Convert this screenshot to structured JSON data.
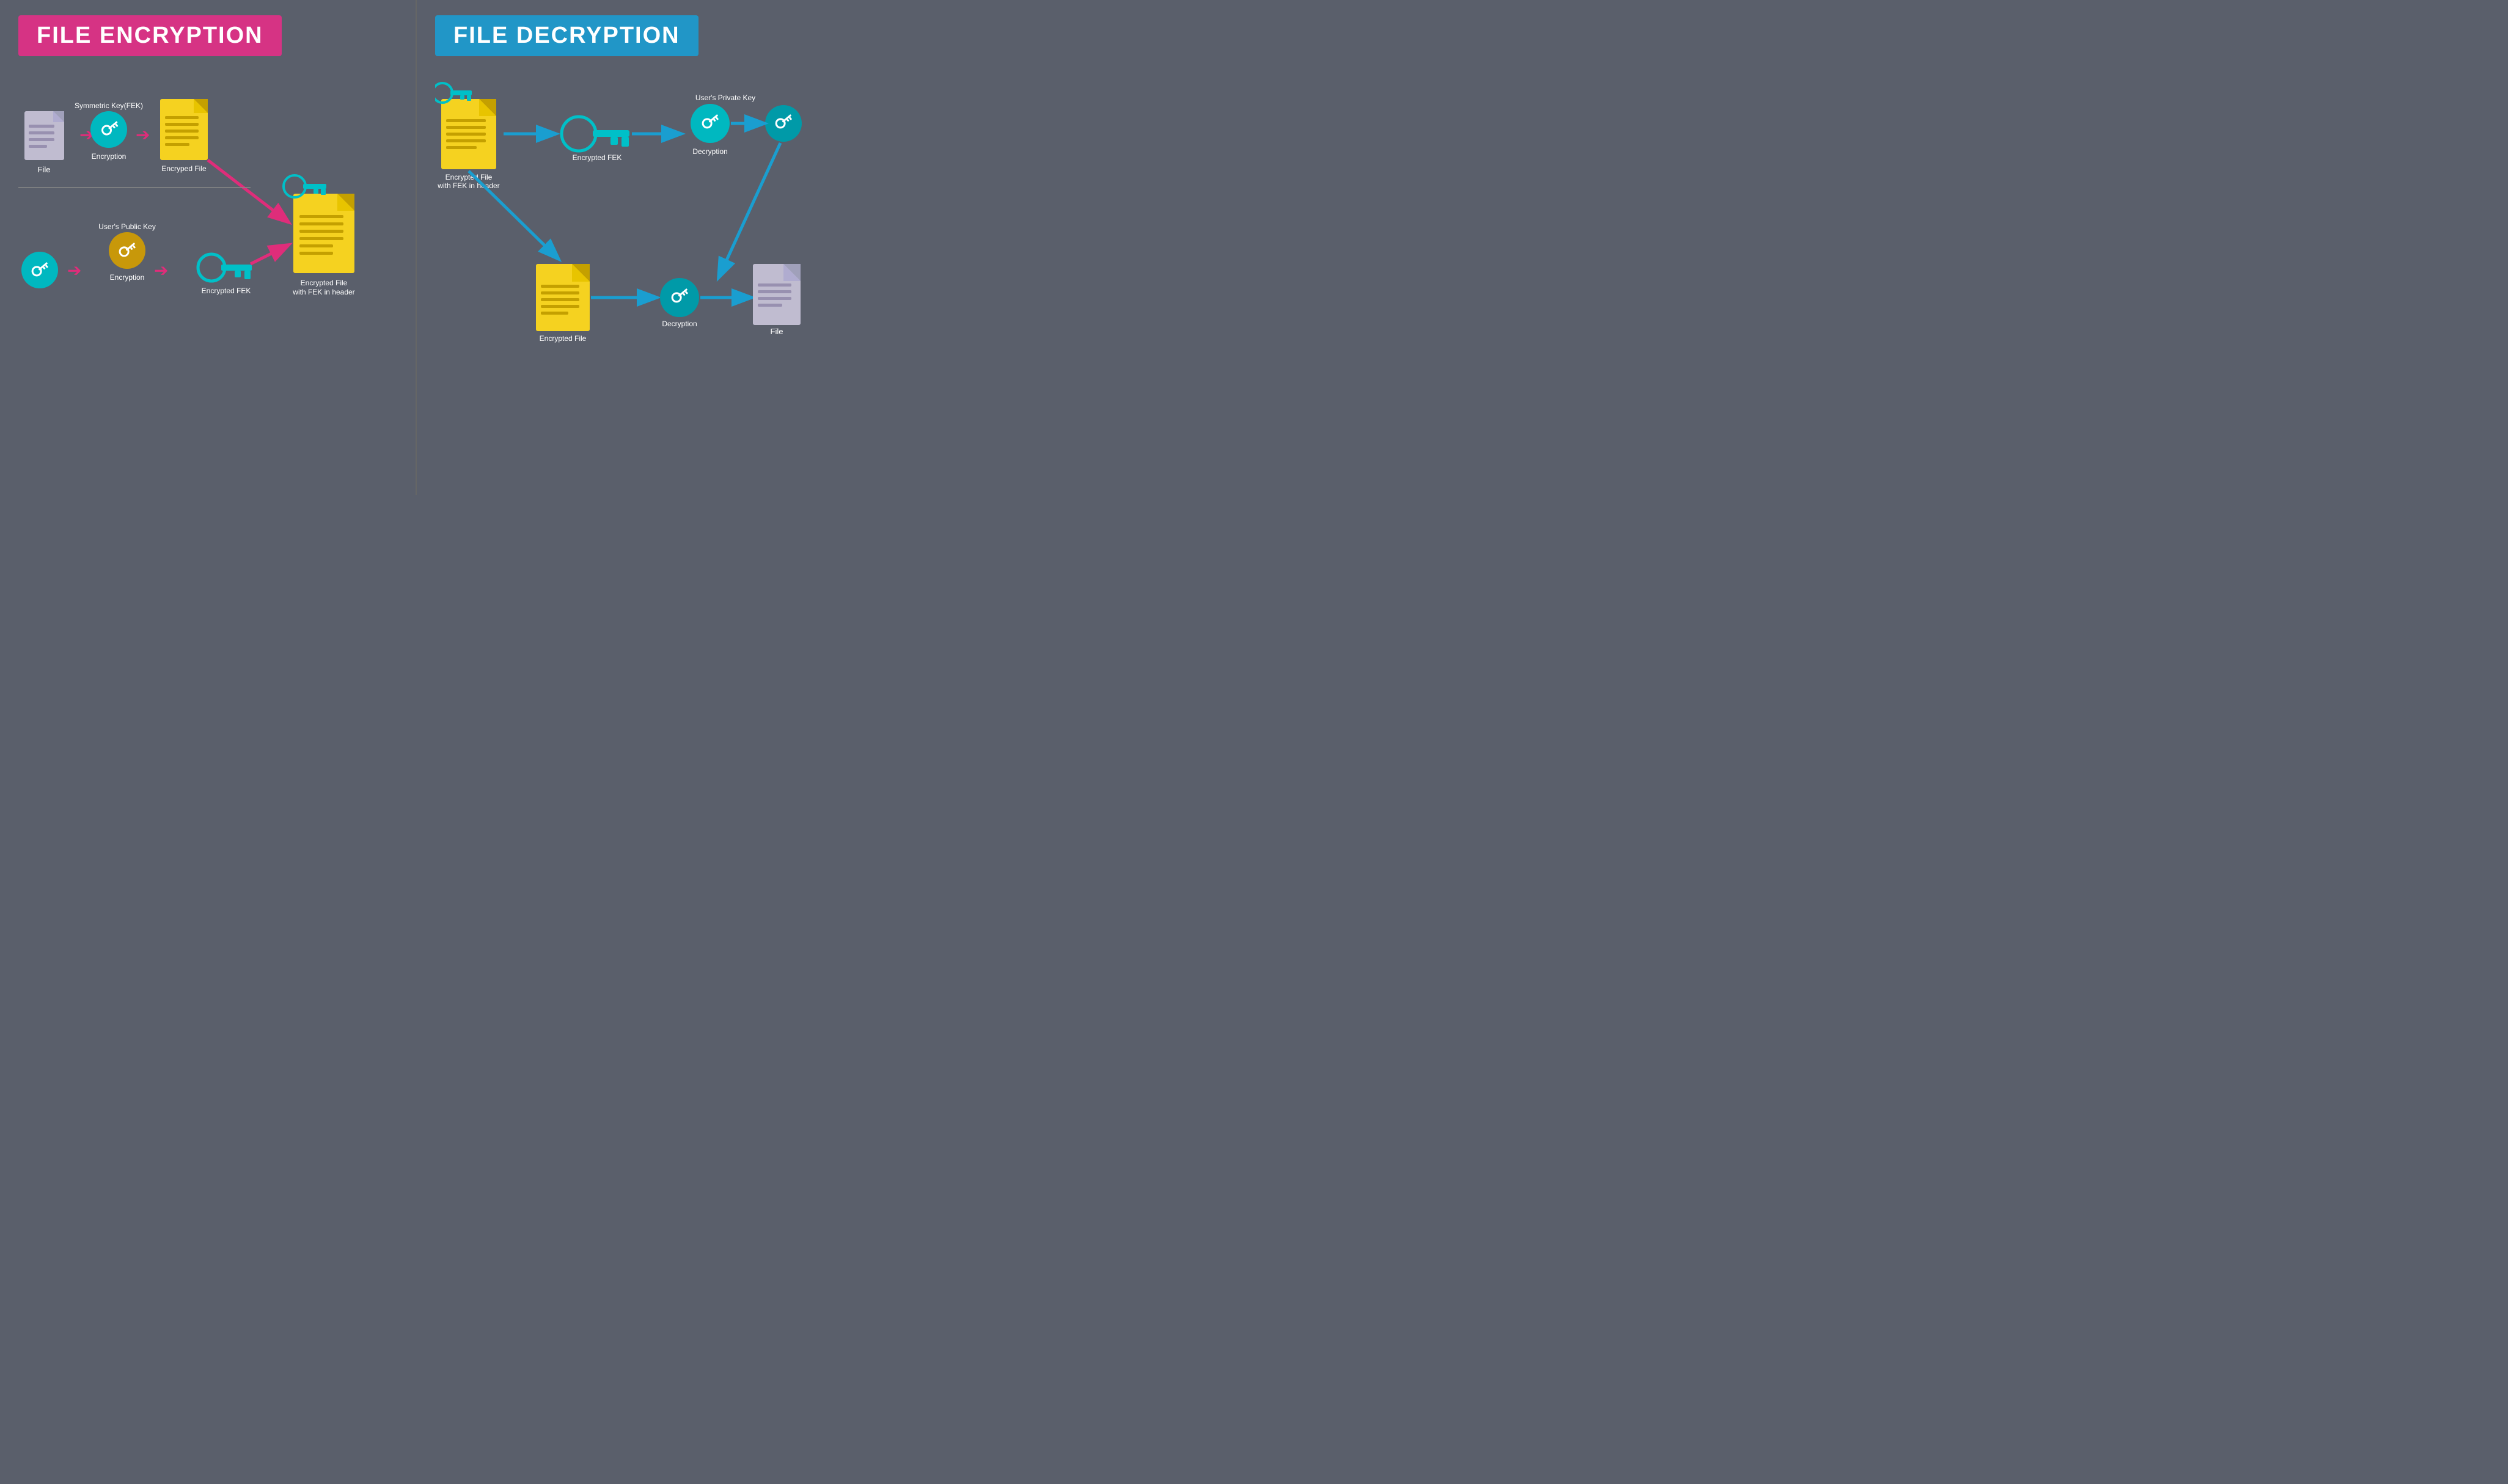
{
  "left": {
    "title": "FILE ENCRYPTION",
    "topRow": {
      "file_label": "File",
      "sym_key_label": "Symmetric Key(FEK)",
      "encryption_label": "Encryption",
      "encrypted_file_label": "Encryped File"
    },
    "bottomRow": {
      "pub_key_label": "User's Public Key",
      "encryption_label": "Encryption",
      "encrypted_fek_label": "Encrypted FEK"
    },
    "combined_label": "Encrypted File\nwith FEK in header"
  },
  "right": {
    "title": "FILE DECRYPTION",
    "topRow": {
      "enc_file_label": "Encrypted File\nwith FEK in header",
      "encrypted_fek_label": "Encrypted FEK",
      "priv_key_label": "User's Private Key",
      "decryption_label": "Decryption"
    },
    "bottomRow": {
      "enc_file_label2": "Encrypted File",
      "decryption_label2": "Decryption",
      "file_label": "File"
    }
  },
  "colors": {
    "bg": "#5a5f6b",
    "enc_banner": "#d63384",
    "dec_banner": "#2196c7",
    "teal": "#00b8c0",
    "gold": "#c8980a",
    "yellow_doc": "#f5d220",
    "gray_doc": "#c0bcd0",
    "arrow_pink": "#df2d7a",
    "arrow_blue": "#1a9ed0"
  }
}
